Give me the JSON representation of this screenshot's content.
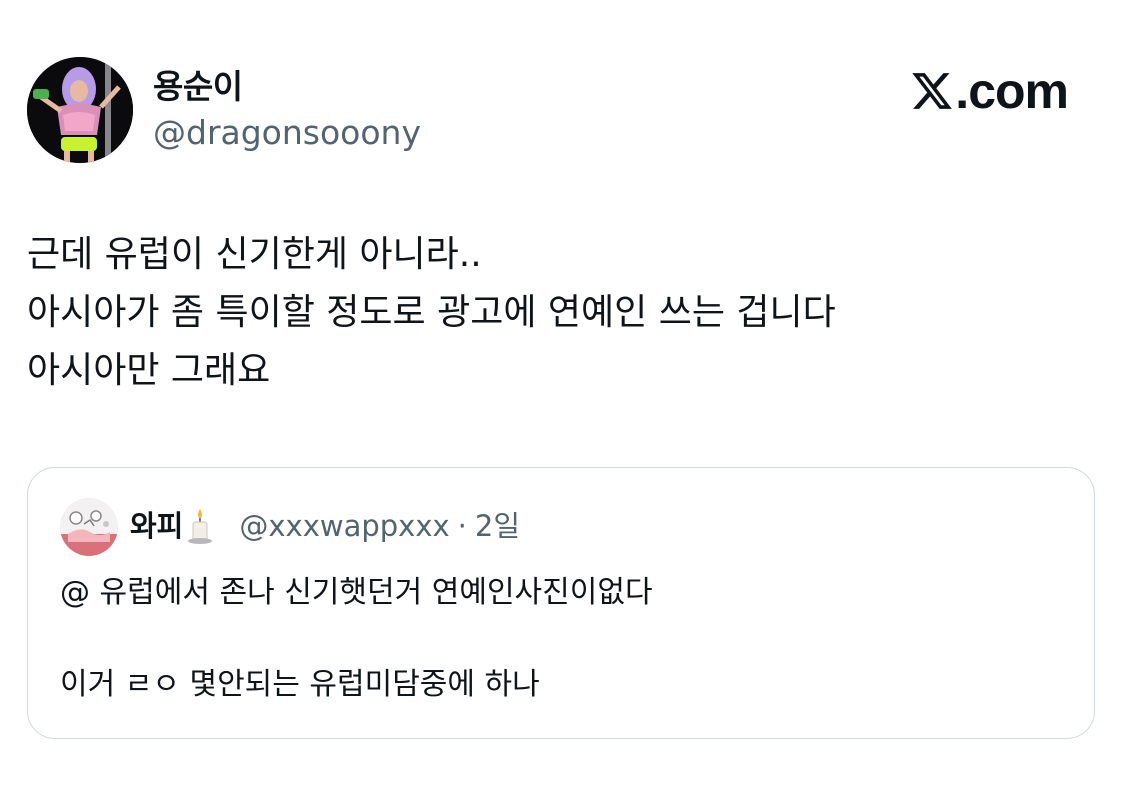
{
  "author": {
    "display_name": "용순이",
    "handle": "@dragonsooony",
    "avatar_icon": "profile-photo"
  },
  "brand": {
    "logo_icon": "x-logo-icon",
    "domain_text": ".com"
  },
  "tweet": {
    "lines": [
      "근데 유럽이 신기한게 아니라..",
      "아시아가 좀 특이할 정도로 광고에 연예인 쓰는 겁니다",
      "아시아만 그래요"
    ]
  },
  "quoted_tweet": {
    "display_name": "와피",
    "name_emoji": "candle-icon",
    "handle": "@xxxwappxxx",
    "separator": "·",
    "time": "2일",
    "lines": [
      "@ 유럽에서 존나 신기햇던거 연예인사진이없다",
      "",
      "이거 ㄹㅇ 몇안되는 유럽미담중에 하나"
    ]
  },
  "colors": {
    "text_primary": "#0f1419",
    "text_secondary": "#536471",
    "border": "#cfd9de",
    "background": "#ffffff"
  }
}
